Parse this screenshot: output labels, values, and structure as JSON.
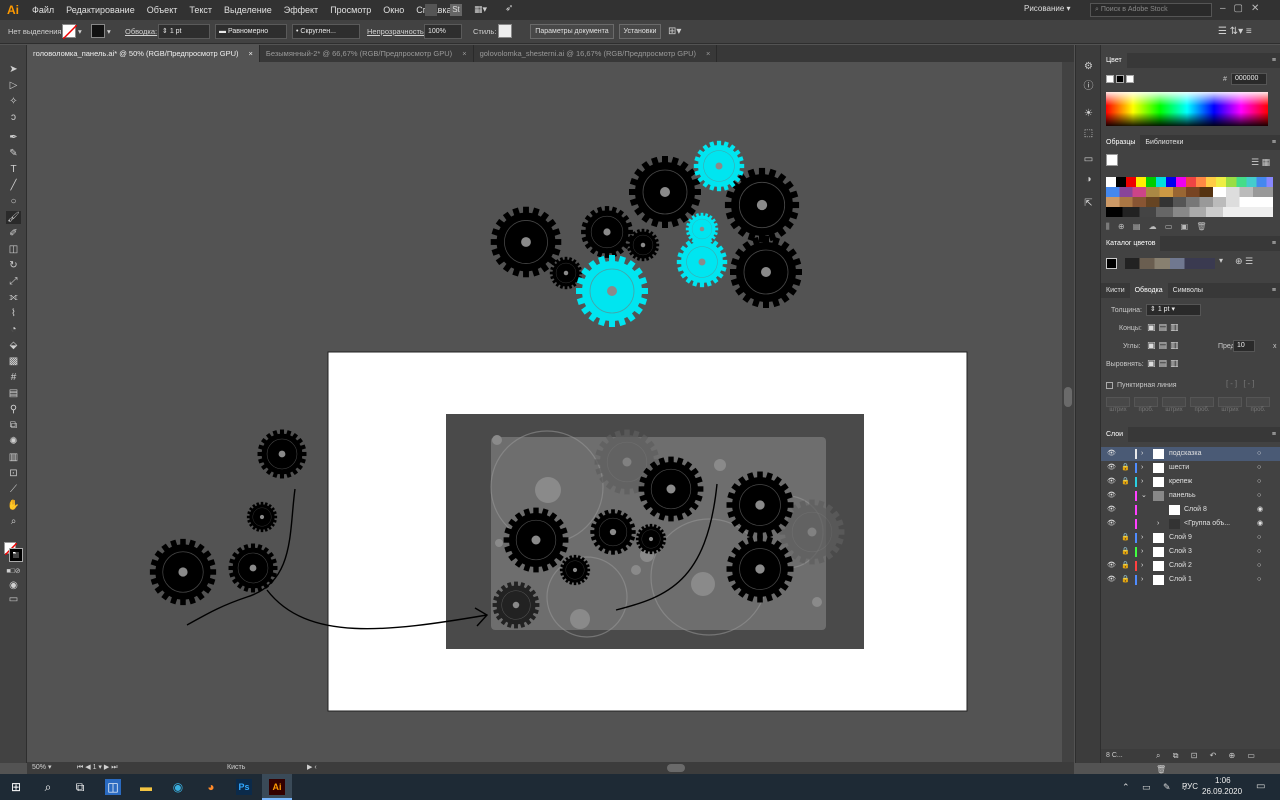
{
  "app": {
    "logo": "Ai",
    "workspace": "Рисование",
    "stock_search_placeholder": "Поиск в Adobe Stock"
  },
  "menu": [
    "Файл",
    "Редактирование",
    "Объект",
    "Текст",
    "Выделение",
    "Эффект",
    "Просмотр",
    "Окно",
    "Справка"
  ],
  "control": {
    "selection": "Нет выделения",
    "stroke_label": "Обводка:",
    "stroke_weight": "1 pt",
    "profile": "Равномерно",
    "brush": "Скруглен...",
    "opacity_label": "Непрозрачность:",
    "opacity": "100%",
    "style_label": "Стиль:",
    "doc_setup": "Параметры документа",
    "prefs": "Установки"
  },
  "tabs": [
    {
      "label": "головоломка_панель.ai* @ 50% (RGB/Предпросмотр GPU)",
      "close": "×"
    },
    {
      "label": "Безымянный-2* @ 66,67% (RGB/Предпросмотр GPU)",
      "close": "×"
    },
    {
      "label": "golovolomka_shesterni.ai @ 16,67% (RGB/Предпросмотр GPU)",
      "close": "×"
    }
  ],
  "status": {
    "zoom": "50%",
    "artboard": "1",
    "tool": "Кисть"
  },
  "panels": {
    "color": {
      "title": "Цвет",
      "hex_prefix": "#",
      "hex": "000000"
    },
    "swatches": {
      "tab1": "Образцы",
      "tab2": "Библиотеки"
    },
    "color_guide": {
      "title": "Каталог цветов"
    },
    "stroke": {
      "tab1": "Кисти",
      "tab2": "Обводка",
      "tab3": "Символы",
      "weight_label": "Толщина:",
      "weight": "1 pt",
      "caps_label": "Концы:",
      "corners_label": "Углы:",
      "limit_label": "Предел:",
      "limit": "10",
      "limit_suffix": "x",
      "align_label": "Выровнять:",
      "dashed": "Пунктирная линия",
      "dash_labels": [
        "штрих",
        "проб.",
        "штрих",
        "проб.",
        "штрих",
        "проб."
      ]
    },
    "layers": {
      "title": "Слои",
      "count": "8 С...",
      "items": [
        {
          "name": "подсказка",
          "color": "#e8e8e8"
        },
        {
          "name": "шести",
          "color": "#4f8cff"
        },
        {
          "name": "крепеж",
          "color": "#2ad0e0"
        },
        {
          "name": "панельь",
          "color": "#ff40ff"
        },
        {
          "name": "Слой 8",
          "color": "#ff40ff"
        },
        {
          "name": "<Группа объ...",
          "color": "#ff40ff"
        },
        {
          "name": "Слой 9",
          "color": "#4f8cff"
        },
        {
          "name": "Слой 3",
          "color": "#40ff40"
        },
        {
          "name": "Слой 2",
          "color": "#ff4040"
        },
        {
          "name": "Слой 1",
          "color": "#4f8cff"
        }
      ]
    }
  },
  "taskbar": {
    "lang": "РУС",
    "time": "1:06",
    "date": "26.09.2020"
  },
  "colors": {
    "accent": "#00e5f0",
    "gear": "#000000",
    "panel_dark": "#4a4a4a",
    "panel_light": "#6e6e6e"
  }
}
